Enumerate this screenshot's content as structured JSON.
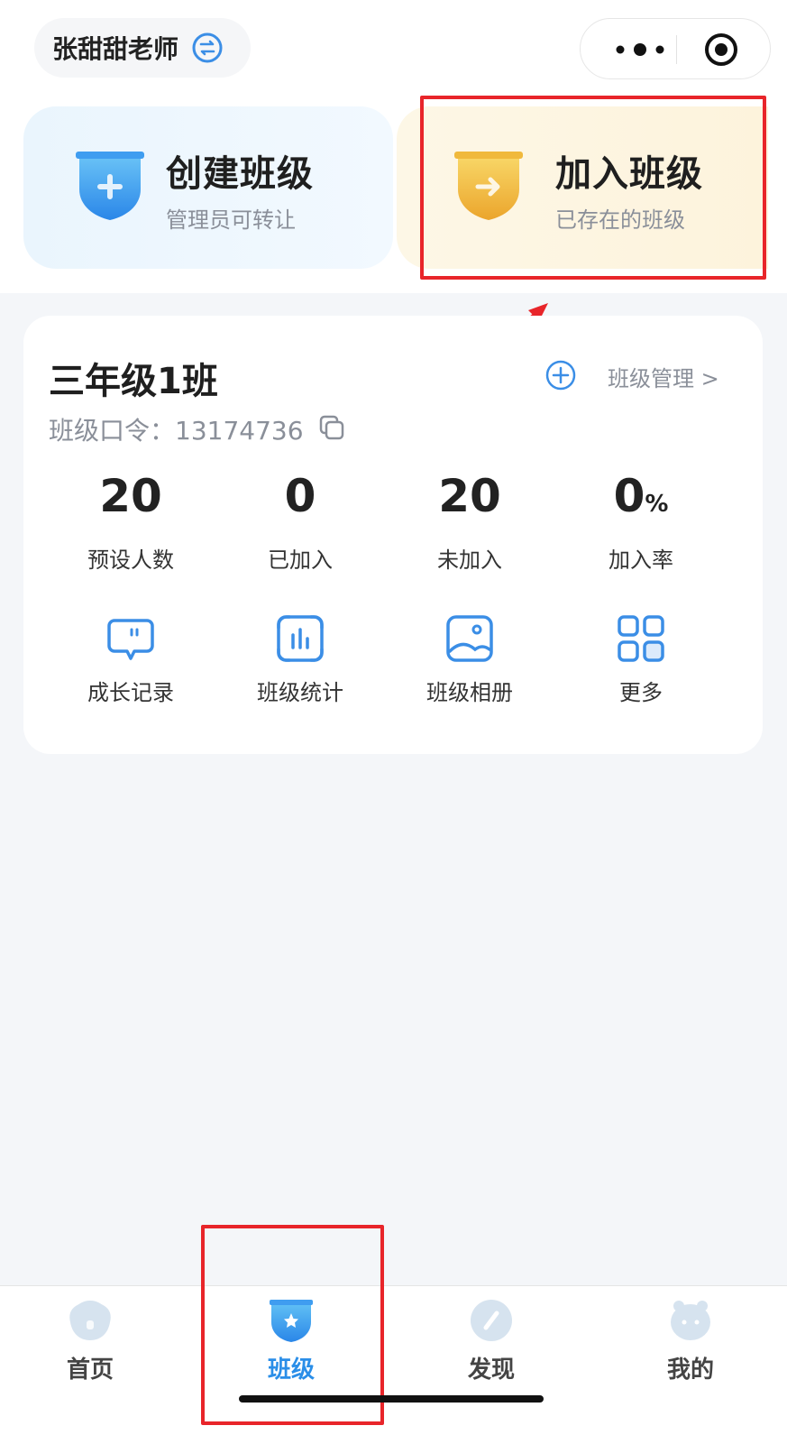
{
  "header": {
    "user_name": "张甜甜老师",
    "switch_icon": "switch-icon",
    "menu_icon": "more-dots-icon",
    "close_icon": "target-icon"
  },
  "actions": {
    "create": {
      "title": "创建班级",
      "subtitle": "管理员可转让",
      "icon": "shield-plus-icon"
    },
    "join": {
      "title": "加入班级",
      "subtitle": "已存在的班级",
      "icon": "shield-arrow-icon"
    }
  },
  "class_card": {
    "name": "三年级1班",
    "manage_label": "班级管理 >",
    "code_text": "班级口令：13174736",
    "stats": [
      {
        "value": "20",
        "unit": "",
        "label": "预设人数"
      },
      {
        "value": "0",
        "unit": "",
        "label": "已加入"
      },
      {
        "value": "20",
        "unit": "",
        "label": "未加入"
      },
      {
        "value": "0",
        "unit": "%",
        "label": "加入率"
      }
    ],
    "tools": [
      {
        "label": "成长记录",
        "icon": "chat-bubble-icon"
      },
      {
        "label": "班级统计",
        "icon": "bar-stats-icon"
      },
      {
        "label": "班级相册",
        "icon": "photo-album-icon"
      },
      {
        "label": "更多",
        "icon": "grid-more-icon"
      }
    ]
  },
  "tabbar": {
    "tabs": [
      {
        "label": "首页",
        "icon": "home-icon",
        "active": false
      },
      {
        "label": "班级",
        "icon": "class-shield-icon",
        "active": true
      },
      {
        "label": "发现",
        "icon": "discover-icon",
        "active": false
      },
      {
        "label": "我的",
        "icon": "profile-icon",
        "active": false
      }
    ]
  },
  "colors": {
    "accent": "#2a8ee8",
    "highlight": "#e8252a",
    "join_bg": "#fdf5e2",
    "create_bg": "#eef7fe"
  }
}
